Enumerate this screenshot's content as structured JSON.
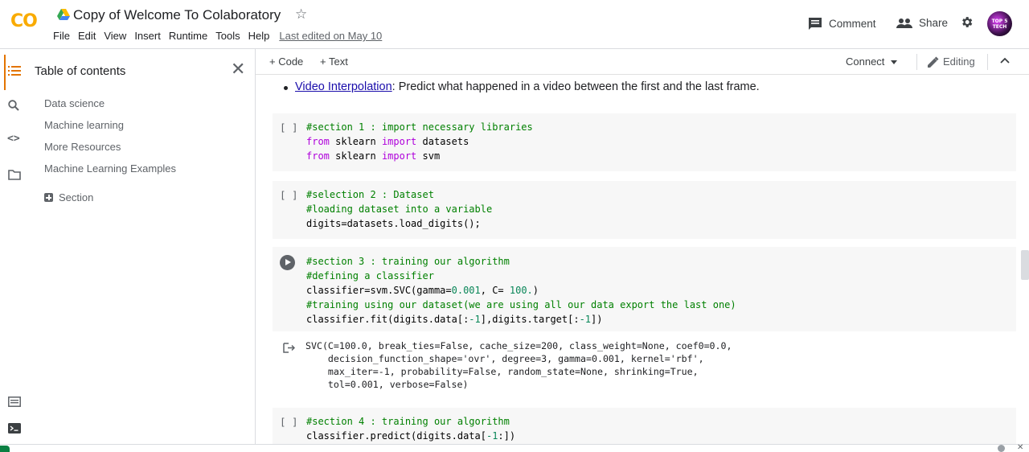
{
  "app": {
    "logo_text": "CO",
    "doc_title": "Copy of Welcome To Colaboratory",
    "menu": [
      "File",
      "Edit",
      "View",
      "Insert",
      "Runtime",
      "Tools",
      "Help"
    ],
    "last_edited": "Last edited on May 10",
    "comment_label": "Comment",
    "share_label": "Share",
    "avatar_text": "TOP 5 TECH",
    "accent_color": "#f9ab00"
  },
  "toc": {
    "title": "Table of contents",
    "items": [
      "Data science",
      "Machine learning",
      "More Resources",
      "Machine Learning Examples"
    ],
    "section_label": "Section"
  },
  "toolbar": {
    "add_code": "+ Code",
    "add_text": "+ Text",
    "connect": "Connect",
    "editing": "Editing"
  },
  "notebook": {
    "bullet_link": "Video Interpolation",
    "bullet_text": ": Predict what happened in a video between the first and the last frame.",
    "run_bracket": "[ ]",
    "cells": [
      {
        "lines": [
          {
            "c": "#section 1 : import necessary libraries"
          },
          {
            "kw1": "from",
            "mid": " sklearn ",
            "kw2": "import",
            "tail": " datasets"
          },
          {
            "kw1": "from",
            "mid": " sklearn ",
            "kw2": "import",
            "tail": " svm"
          }
        ]
      },
      {
        "lines": [
          "#selection 2 : Dataset",
          "#loading dataset into a variable",
          "digits=datasets.load_digits();"
        ]
      },
      {
        "lines": [
          "#section 3 : training our algorithm",
          "#defining a classifier",
          {
            "a": "classifier=svm.SVC(gamma=",
            "n1": "0.001",
            "b": ", C= ",
            "n2": "100.",
            "c": ")"
          },
          "#training using our dataset(we are using all our data export the last one)",
          {
            "a": "classifier.fit(digits.data[:",
            "n1": "-1",
            "b": "],digits.target[:",
            "n2": "-1",
            "c": "])"
          }
        ],
        "output": "SVC(C=100.0, break_ties=False, cache_size=200, class_weight=None, coef0=0.0,\n    decision_function_shape='ovr', degree=3, gamma=0.001, kernel='rbf',\n    max_iter=-1, probability=False, random_state=None, shrinking=True,\n    tol=0.001, verbose=False)"
      },
      {
        "lines": [
          "#section 4 : training our algorithm",
          {
            "a": "classifier.predict(digits.data[",
            "n1": "-1",
            "b": ":])"
          }
        ]
      }
    ]
  }
}
